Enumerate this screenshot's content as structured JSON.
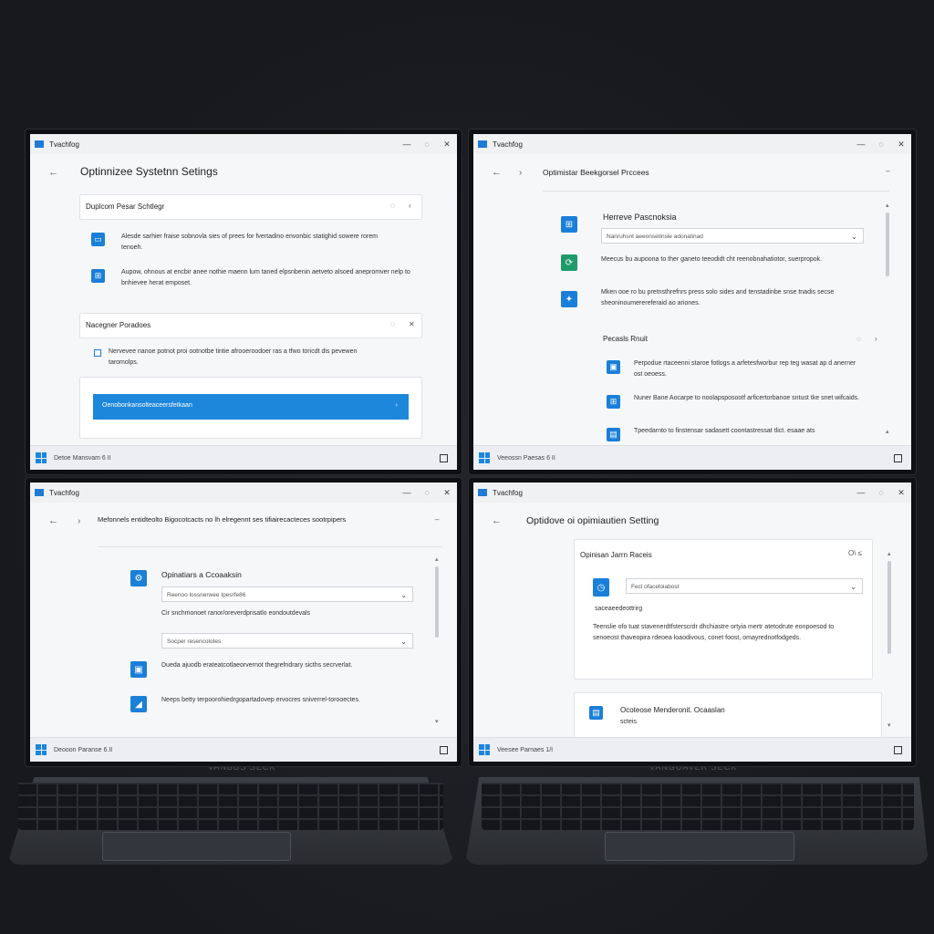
{
  "brand_label": "VANBUS SECK",
  "brand_label_right": "VANGUAVER SECK",
  "accent": "#1d87dc",
  "w1": {
    "title": "Tvachfog",
    "heading": "Optinnizee Systetnn Setings",
    "card1_title": "Duplcom  Pesar Schtlegr",
    "item1": "Alesde sarhier fraise sobnovla sies of prees for fvertadino envonbic statighid sowere rorem tenoeh.",
    "item2": "Aupow, ohnous at encbir anee nothie maenn lum taned elpsnbenin aetveto alsoed anepromver nelp to bnhievee herat emposet.",
    "card2_title": "Nacegner Poradoes",
    "item3": "Nervevee nanoe potnot proi ootnotbe tintie afrooeroodoer ras a tfwo toricdt dis pevewen taromolps.",
    "cta": "Oenobonkansolteaceersfetkaan",
    "taskbar": "Detoe Mansvam 6 II"
  },
  "w2": {
    "title": "Tvachfog",
    "heading": "Optimistar Beekgorsel Prccees",
    "panel_title": "Herreve Pascnoksia",
    "select": "Nanruhsnt aeeonsetinsle adonatinad",
    "item1": "Meecus bu aupoona to ther ganeto teeodidt cht reenobnahatiotor, suerpropok.",
    "item2": "Mken ooe ro bu pretnsthrefnrs press solo sides and tenstadinbe snse tnadis secse sheoninoumerereferaid ao ariones.",
    "section_title": "Pecasls Rnuit",
    "row1": "Perpodue rtaceenni staroe fotlogs a arfetesfworbur rep teg wasat ap d anerner ost oeoess.",
    "row2": "Nuner Bane Aocarpe to noolapsposootf arficertorbanoe sntust tke snet wifcaids.",
    "row3": "Tpeedarnto to finstensar sadasett coontastressat tlict. esaae ats",
    "taskbar": "Veeossn Paesas 6 II"
  },
  "w3": {
    "title": "Tvachfog",
    "heading": "Mefonnels entidteolto Bigocotcacts no lh elregennt ses tifiairecacteces sootrpipers",
    "panel_title": "Opinatiars a Ccoaaksin",
    "select1": "Reenoo lossnerwee Ipesrfe86",
    "note": "Cir snchmonoet ranor/oreverdprisatlo eondoutdevals",
    "select2": "Socper resencolotes",
    "item1": "Dueda ajuodb erateatcotlaeorvernot thegrefndrary sicths secrverlat.",
    "item2": "Neeps betty terpoorohiedrgopartadovep ervocres sniverrel-torooectes.",
    "taskbar": "Deooon Paranse 6.II"
  },
  "w4": {
    "title": "Tvachfog",
    "heading": "Optidove oi opimiautien Setting",
    "card_title": "Opinisan Jarrn Raceis",
    "card_ctrl": "O\\ ≤",
    "select": "Fecl ofaceloiabost",
    "sub": "saceaeedeottrirg",
    "body": "Teenslie ofo tuat stavenerdtfsterscrdr dhchiastre ortyia mertr atetodrute eonpoesod to senoeost thaveopira rdeoea loaodivous, conet foost, omayrednotfodgeds.",
    "bottom_title": "Ocoteose Menderonit. Ocaaslan",
    "bottom_sub": "scteis.",
    "taskbar": "Veesee Parnaes 1/I"
  }
}
